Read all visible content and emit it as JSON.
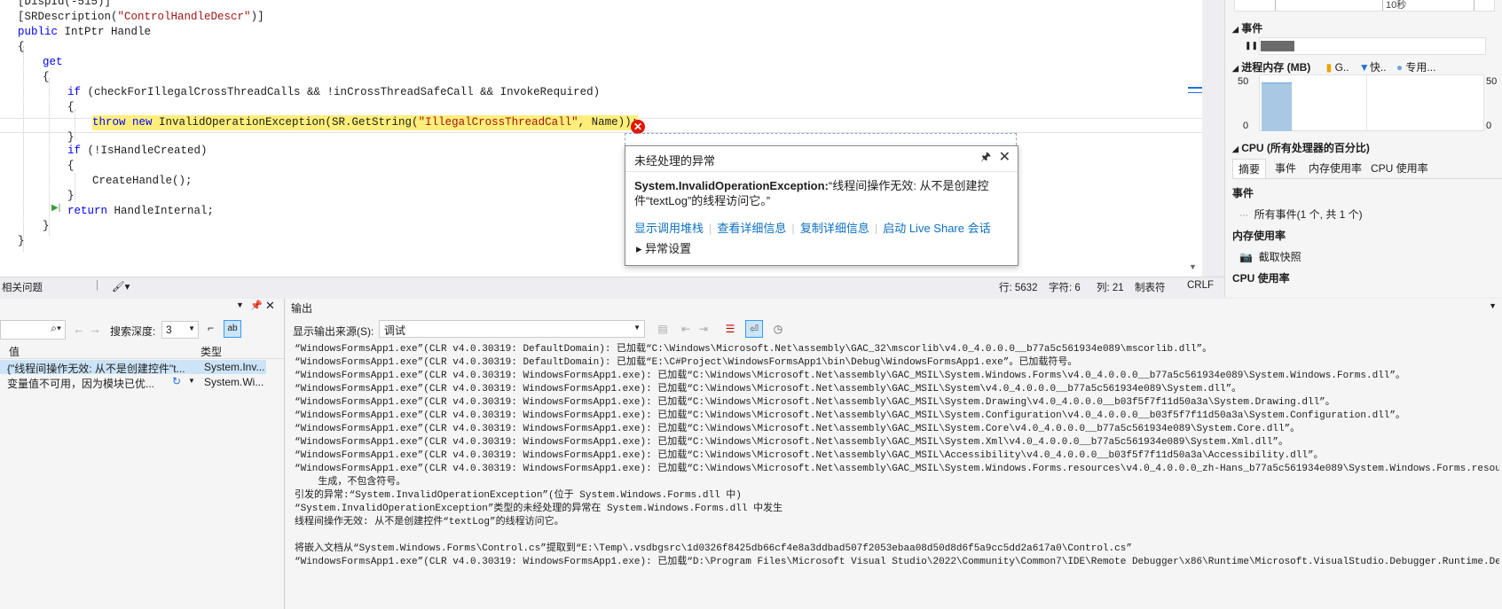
{
  "editor": {
    "lines": [
      {
        "segments": [
          {
            "t": "[DispId(-515)]",
            "c": ""
          }
        ]
      },
      {
        "segments": [
          {
            "t": "[SRDescription(",
            "c": ""
          },
          {
            "t": "\"ControlHandleDescr\"",
            "c": "str"
          },
          {
            "t": ")]",
            "c": ""
          }
        ]
      },
      {
        "segments": [
          {
            "t": "public ",
            "c": "kw"
          },
          {
            "t": "IntPtr Handle",
            "c": ""
          }
        ]
      },
      {
        "segments": [
          {
            "t": "{",
            "c": ""
          }
        ]
      },
      {
        "segments": [
          {
            "t": "get",
            "c": "kw"
          }
        ]
      },
      {
        "segments": [
          {
            "t": "{",
            "c": ""
          }
        ]
      },
      {
        "segments": [
          {
            "t": "if ",
            "c": "kw"
          },
          {
            "t": "(checkForIllegalCrossThreadCalls && !inCrossThreadSafeCall && InvokeRequired)",
            "c": ""
          }
        ]
      },
      {
        "segments": [
          {
            "t": "{",
            "c": ""
          }
        ]
      },
      {
        "segments": [
          {
            "t": "throw new ",
            "c": "kw"
          },
          {
            "t": "InvalidOperationException(SR.GetString(",
            "c": ""
          },
          {
            "t": "\"IllegalCrossThreadCall\"",
            "c": "str"
          },
          {
            "t": ", Name));",
            "c": ""
          }
        ]
      },
      {
        "segments": [
          {
            "t": "}",
            "c": ""
          }
        ]
      },
      {
        "segments": [
          {
            "t": "if ",
            "c": "kw"
          },
          {
            "t": "(!IsHandleCreated)",
            "c": ""
          }
        ]
      },
      {
        "segments": [
          {
            "t": "{",
            "c": ""
          }
        ]
      },
      {
        "segments": [
          {
            "t": "CreateHandle();",
            "c": ""
          }
        ]
      },
      {
        "segments": [
          {
            "t": "}",
            "c": ""
          }
        ]
      },
      {
        "segments": [
          {
            "t": "return ",
            "c": "kw"
          },
          {
            "t": "HandleInternal;",
            "c": ""
          }
        ]
      },
      {
        "segments": [
          {
            "t": "}",
            "c": ""
          }
        ]
      },
      {
        "segments": [
          {
            "t": "}",
            "c": ""
          }
        ]
      }
    ],
    "error_glyph": "✕"
  },
  "status": {
    "issues": "相关问题",
    "line": "行: 5632",
    "char": "字符: 6",
    "col": "列: 21",
    "tabs": "制表符",
    "eol": "CRLF"
  },
  "exception": {
    "title": "未经处理的异常",
    "type": "System.InvalidOperationException:",
    "message": "“线程间操作无效: 从不是创建控件“textLog”的线程访问它。”",
    "links": [
      "显示调用堆栈",
      "查看详细信息",
      "复制详细信息",
      "启动 Live Share 会话"
    ],
    "settings": "异常设置"
  },
  "diag": {
    "time_label": "10秒",
    "events_title": "事件",
    "memory_title": "进程内存 (MB)",
    "legend": [
      "G..",
      "快..",
      "专用..."
    ],
    "mem_max": "50",
    "mem_min": "0",
    "mem_max_r": "50",
    "mem_min_r": "0",
    "cpu_title": "CPU (所有处理器的百分比)",
    "tabs": [
      "摘要",
      "事件",
      "内存使用率",
      "CPU 使用率"
    ],
    "events_sec": "事件",
    "all_events": "所有事件(1 个, 共 1 个)",
    "mem_usage_sec": "内存使用率",
    "snapshot": "截取快照",
    "cpu_usage_sec": "CPU 使用率",
    "colors": {
      "gen": "#e8a500",
      "fast": "#1e6fd9",
      "private": "#6fa8dc",
      "mem_fill": "#a9c8e3"
    }
  },
  "locals": {
    "search_depth_label": "搜索深度:",
    "search_depth_value": "3",
    "col_value": "值",
    "col_type": "类型",
    "rows": [
      {
        "value": "{\"线程间操作无效: 从不是创建控件\"t...",
        "type": "System.Inv..."
      },
      {
        "value": "变量值不可用，因为模块已优...",
        "type": "System.Wi..."
      }
    ]
  },
  "output": {
    "title": "输出",
    "source_label": "显示输出来源(S):",
    "source_value": "调试",
    "lines": [
      "“WindowsFormsApp1.exe”(CLR v4.0.30319: DefaultDomain): 已加载“C:\\Windows\\Microsoft.Net\\assembly\\GAC_32\\mscorlib\\v4.0_4.0.0.0__b77a5c561934e089\\mscorlib.dll”。",
      "“WindowsFormsApp1.exe”(CLR v4.0.30319: DefaultDomain): 已加载“E:\\C#Project\\WindowsFormsApp1\\bin\\Debug\\WindowsFormsApp1.exe”。已加载符号。",
      "“WindowsFormsApp1.exe”(CLR v4.0.30319: WindowsFormsApp1.exe): 已加载“C:\\Windows\\Microsoft.Net\\assembly\\GAC_MSIL\\System.Windows.Forms\\v4.0_4.0.0.0__b77a5c561934e089\\System.Windows.Forms.dll”。",
      "“WindowsFormsApp1.exe”(CLR v4.0.30319: WindowsFormsApp1.exe): 已加载“C:\\Windows\\Microsoft.Net\\assembly\\GAC_MSIL\\System\\v4.0_4.0.0.0__b77a5c561934e089\\System.dll”。",
      "“WindowsFormsApp1.exe”(CLR v4.0.30319: WindowsFormsApp1.exe): 已加载“C:\\Windows\\Microsoft.Net\\assembly\\GAC_MSIL\\System.Drawing\\v4.0_4.0.0.0__b03f5f7f11d50a3a\\System.Drawing.dll”。",
      "“WindowsFormsApp1.exe”(CLR v4.0.30319: WindowsFormsApp1.exe): 已加载“C:\\Windows\\Microsoft.Net\\assembly\\GAC_MSIL\\System.Configuration\\v4.0_4.0.0.0__b03f5f7f11d50a3a\\System.Configuration.dll”。",
      "“WindowsFormsApp1.exe”(CLR v4.0.30319: WindowsFormsApp1.exe): 已加载“C:\\Windows\\Microsoft.Net\\assembly\\GAC_MSIL\\System.Core\\v4.0_4.0.0.0__b77a5c561934e089\\System.Core.dll”。",
      "“WindowsFormsApp1.exe”(CLR v4.0.30319: WindowsFormsApp1.exe): 已加载“C:\\Windows\\Microsoft.Net\\assembly\\GAC_MSIL\\System.Xml\\v4.0_4.0.0.0__b77a5c561934e089\\System.Xml.dll”。",
      "“WindowsFormsApp1.exe”(CLR v4.0.30319: WindowsFormsApp1.exe): 已加载“C:\\Windows\\Microsoft.Net\\assembly\\GAC_MSIL\\Accessibility\\v4.0_4.0.0.0__b03f5f7f11d50a3a\\Accessibility.dll”。",
      "“WindowsFormsApp1.exe”(CLR v4.0.30319: WindowsFormsApp1.exe): 已加载“C:\\Windows\\Microsoft.Net\\assembly\\GAC_MSIL\\System.Windows.Forms.resources\\v4.0_4.0.0.0_zh-Hans_b77a5c561934e089\\System.Windows.Forms.resources.dll”。模块已",
      "    生成，不包含符号。",
      "引发的异常:“System.InvalidOperationException”(位于 System.Windows.Forms.dll 中)",
      "“System.InvalidOperationException”类型的未经处理的异常在 System.Windows.Forms.dll 中发生",
      "线程间操作无效: 从不是创建控件“textLog”的线程访问它。",
      "",
      "将嵌入文档从“System.Windows.Forms\\Control.cs”提取到“E:\\Temp\\.vsdbgsrc\\1d0326f8425db66cf4e8a3ddbad507f2053ebaa08d50d8d6f5a9cc5dd2a617a0\\Control.cs”",
      "“WindowsFormsApp1.exe”(CLR v4.0.30319: WindowsFormsApp1.exe): 已加载“D:\\Program Files\\Microsoft Visual Studio\\2022\\Community\\Common7\\IDE\\Remote Debugger\\x86\\Runtime\\Microsoft.VisualStudio.Debugger.Runtime.Desktop.dll”。"
    ]
  }
}
